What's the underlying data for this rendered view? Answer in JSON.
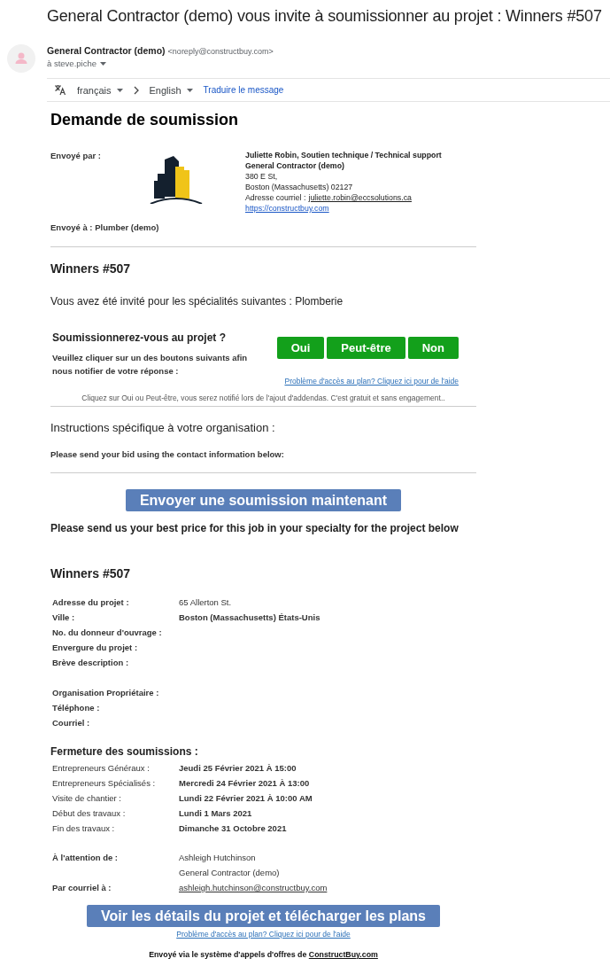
{
  "subject": "General Contractor (demo) vous invite à soumissionner au projet : Winners #507",
  "sender": {
    "name": "General Contractor (demo)",
    "address": "<noreply@constructbuy.com>",
    "recipient": "à steve.piche"
  },
  "translate_bar": {
    "source_language": "français",
    "target_language": "English",
    "action": "Traduire le message"
  },
  "heading": "Demande de soumission",
  "sent_by": {
    "label": "Envoyé par :",
    "contact": [
      {
        "kind": "bold",
        "text": "Juliette Robin, Soutien technique / Technical support"
      },
      {
        "kind": "bold",
        "text": "General Contractor (demo)"
      },
      {
        "kind": "plain",
        "text": "380 E St,"
      },
      {
        "kind": "plain",
        "text": "Boston (Massachusetts) 02127"
      },
      {
        "kind": "email",
        "text": "Adresse courriel :",
        "link": "juliette.robin@eccsolutions.ca"
      },
      {
        "kind": "link",
        "text": "https://constructbuy.com"
      }
    ]
  },
  "sent_to": "Envoyé à : Plumber (demo)",
  "project_title": "Winners #507",
  "invitation": "Vous avez été invité pour les spécialités suivantes : Plomberie",
  "rsvp": {
    "question": "Soumissionnerez-vous au projet ?",
    "instructions": "Veuillez cliquer sur un des boutons suivants afin nous notifier de votre réponse :",
    "buttons": [
      "Oui",
      "Peut-être",
      "Non"
    ],
    "help_link": "Problème d'accès au plan? Cliquez ici pour de l'aide",
    "note": "Cliquez sur Oui ou Peut-être, vous serez notifié lors de l'ajout d'addendas. C'est gratuit et sans engagement.."
  },
  "instructions": {
    "title": "Instructions spécifique à votre organisation :",
    "text": "Please send your bid using the contact information below:"
  },
  "submit_button": "Envoyer une soumission maintenant",
  "request_text": "Please send us your best price for this job in your specialty for the project below",
  "project_title_2": "Winners #507",
  "project_details": [
    {
      "label": "Adresse du projet :",
      "value": "65 Allerton St.",
      "value_bold": false
    },
    {
      "label": "Ville :",
      "value": "Boston (Massachusetts) États-Unis",
      "value_bold": true
    },
    {
      "label": "No. du donneur d'ouvrage :"
    },
    {
      "label": "Envergure du projet :"
    },
    {
      "label": "Brève description :"
    }
  ],
  "owner_details": [
    {
      "label": "Organisation Propriétaire :"
    },
    {
      "label": "Téléphone :"
    },
    {
      "label": "Courriel :"
    }
  ],
  "closing": {
    "title": "Fermeture des soumissions :",
    "rows": [
      {
        "label": "Entrepreneurs Généraux :",
        "value": "Jeudi 25 Février 2021 À 15:00"
      },
      {
        "label": "Entrepreneurs Spécialisés :",
        "value": "Mercredi 24 Février 2021 À 13:00"
      },
      {
        "label": "Visite de chantier :",
        "value": "Lundi 22 Février 2021 À 10:00 AM"
      },
      {
        "label": "Début des travaux :",
        "value": "Lundi 1 Mars 2021"
      },
      {
        "label": "Fin des travaux :",
        "value": "Dimanche 31 Octobre 2021"
      }
    ]
  },
  "attention": {
    "label": "À l'attention de :",
    "lines": [
      "Ashleigh Hutchinson",
      "General Contractor (demo)"
    ]
  },
  "by_email": {
    "label": "Par courriel à :",
    "link": "ashleigh.hutchinson@constructbuy.com"
  },
  "plans_button": "Voir les détails du projet et télécharger les plans",
  "plans_help_link": "Problème d'accès au plan? Cliquez ici pour de l'aide",
  "footer": {
    "text": "Envoyé via le système d'appels d'offres de",
    "link": "ConstructBuy.com"
  }
}
